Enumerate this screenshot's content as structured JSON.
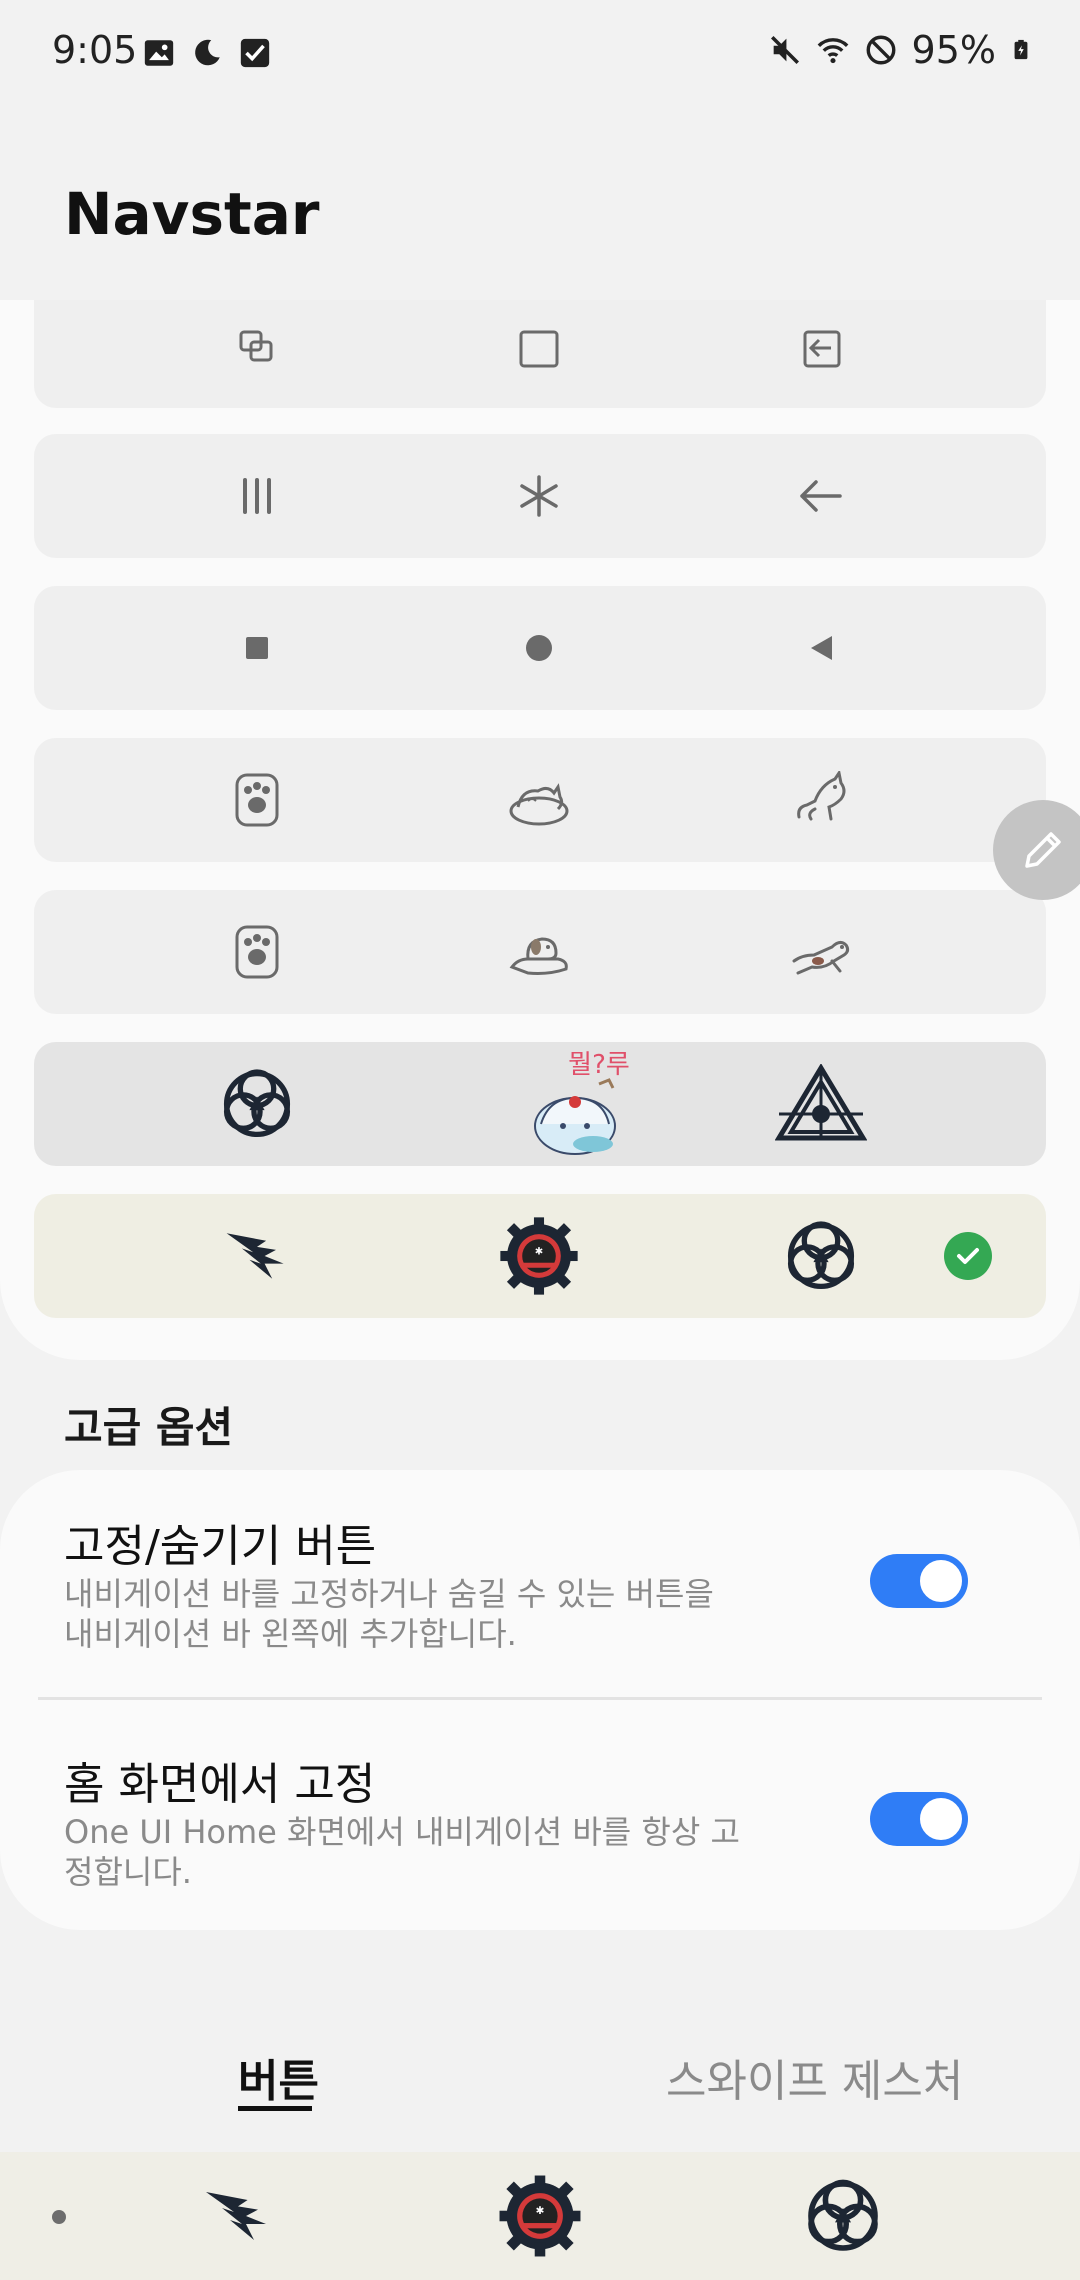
{
  "status_bar": {
    "time": "9:05",
    "left_icons": [
      "image-icon",
      "moon-icon",
      "checkbox-icon"
    ],
    "right_icons": [
      "mute-icon",
      "wifi-icon",
      "dnd-icon",
      "battery-charging-icon"
    ],
    "battery": "95%"
  },
  "header": {
    "title": "Navstar"
  },
  "icon_packs": [
    {
      "icons": [
        "recents-stacked-icon",
        "home-square-icon",
        "back-box-arrow-icon"
      ],
      "selected": false
    },
    {
      "icons": [
        "recents-bars-icon",
        "home-asterisk-icon",
        "back-arrow-icon"
      ],
      "selected": false
    },
    {
      "icons": [
        "recents-filled-square-icon",
        "home-filled-circle-icon",
        "back-triangle-icon"
      ],
      "selected": false
    },
    {
      "icons": [
        "cat-paw-icon",
        "sleeping-cat-icon",
        "stretching-cat-icon"
      ],
      "selected": false
    },
    {
      "icons": [
        "dog-paw-icon",
        "sleeping-dog-icon",
        "running-dog-icon"
      ],
      "selected": false
    },
    {
      "icons": [
        "triskelion-emblem-icon",
        "anime-sticker-icon",
        "eye-triangle-emblem-icon"
      ],
      "selected": false,
      "sticker_text": "뭘?루"
    },
    {
      "icons": [
        "feather-emblem-icon",
        "gear-badge-emblem-icon",
        "triskelion-emblem-icon"
      ],
      "selected": true
    }
  ],
  "edit_fab": {
    "icon": "pencil-icon"
  },
  "advanced": {
    "header": "고급 옵션",
    "options": [
      {
        "title": "고정/숨기기 버튼",
        "description": "내비게이션 바를 고정하거나 숨길 수 있는 버튼을 내비게이션 바 왼쪽에 추가합니다.",
        "enabled": true
      },
      {
        "title": "홈 화면에서 고정",
        "description": "One UI Home 화면에서 내비게이션 바를 항상 고정합니다.",
        "enabled": true
      }
    ]
  },
  "tabs": [
    {
      "label": "버튼",
      "active": true
    },
    {
      "label": "스와이프 제스처",
      "active": false
    }
  ],
  "nav_bar": {
    "icons": [
      "feather-emblem-icon",
      "gear-badge-emblem-icon",
      "triskelion-emblem-icon"
    ]
  },
  "colors": {
    "accent": "#2f7df6",
    "check_green": "#34a853",
    "selected_row": "#efeee3",
    "row": "#efefef"
  }
}
